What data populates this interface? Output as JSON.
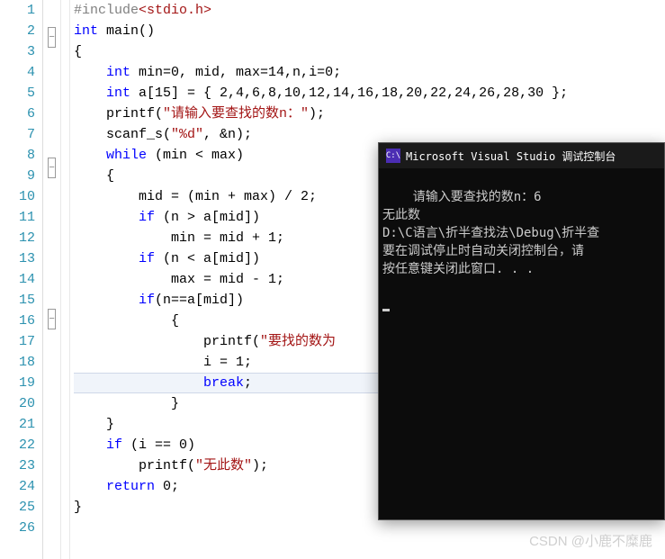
{
  "lines": [
    {
      "n": "1",
      "fold": "",
      "html": "<span class='pp'>#include</span><span class='inc'>&lt;stdio.h&gt;</span>"
    },
    {
      "n": "2",
      "fold": "-",
      "html": "<span class='kw'>int</span> main()"
    },
    {
      "n": "3",
      "fold": "",
      "html": "{"
    },
    {
      "n": "4",
      "fold": "",
      "html": "    <span class='kw'>int</span> min=0, mid, max=14,n,i=0;"
    },
    {
      "n": "5",
      "fold": "",
      "html": "    <span class='kw'>int</span> a[15] = { 2,4,6,8,10,12,14,16,18,20,22,24,26,28,30 };"
    },
    {
      "n": "6",
      "fold": "",
      "html": "    printf(<span class='str'>\"请输入要查找的数n：\"</span>);"
    },
    {
      "n": "7",
      "fold": "",
      "html": "    scanf_s(<span class='str'>\"%d\"</span>, &amp;n);"
    },
    {
      "n": "8",
      "fold": "-",
      "html": "    <span class='kw'>while</span> (min &lt; max)"
    },
    {
      "n": "9",
      "fold": "",
      "html": "    {"
    },
    {
      "n": "10",
      "fold": "",
      "html": "        mid = (min + max) / 2;"
    },
    {
      "n": "11",
      "fold": "",
      "html": "        <span class='kw'>if</span> (n &gt; a[mid])"
    },
    {
      "n": "12",
      "fold": "",
      "html": "            min = mid + 1;"
    },
    {
      "n": "13",
      "fold": "",
      "html": "        <span class='kw'>if</span> (n &lt; a[mid])"
    },
    {
      "n": "14",
      "fold": "",
      "html": "            max = mid - 1;"
    },
    {
      "n": "15",
      "fold": "-",
      "html": "        <span class='kw'>if</span>(n==a[mid])"
    },
    {
      "n": "16",
      "fold": "",
      "html": "            {"
    },
    {
      "n": "17",
      "fold": "",
      "html": "                printf(<span class='str'>\"要找的数为</span>"
    },
    {
      "n": "18",
      "fold": "",
      "html": "                i = 1;"
    },
    {
      "n": "19",
      "fold": "",
      "html": "                <span class='kw'>break</span>;",
      "hl": true
    },
    {
      "n": "20",
      "fold": "",
      "html": "            }"
    },
    {
      "n": "21",
      "fold": "",
      "html": "    }"
    },
    {
      "n": "22",
      "fold": "",
      "html": "    <span class='kw'>if</span> (i == 0)"
    },
    {
      "n": "23",
      "fold": "",
      "html": "        printf(<span class='str'>\"无此数\"</span>);"
    },
    {
      "n": "24",
      "fold": "",
      "html": "    <span class='kw'>return</span> 0;"
    },
    {
      "n": "25",
      "fold": "",
      "html": "}"
    },
    {
      "n": "26",
      "fold": "",
      "html": ""
    }
  ],
  "console": {
    "icon_text": "C:\\",
    "title": "Microsoft Visual Studio 调试控制台",
    "body": "请输入要查找的数n：6\n无此数\nD:\\C语言\\折半查找法\\Debug\\折半查\n要在调试停止时自动关闭控制台，请\n按任意键关闭此窗口. . ."
  },
  "watermark": "CSDN @小鹿不糜鹿"
}
